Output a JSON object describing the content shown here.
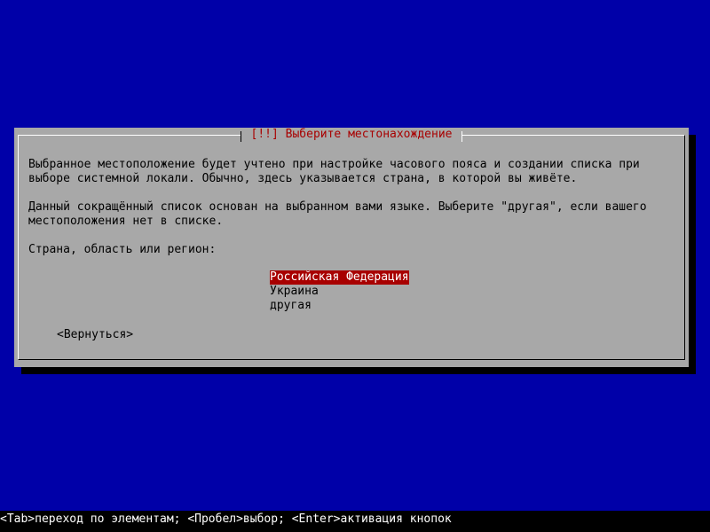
{
  "dialog": {
    "title": "[!!] Выберите местонахождение",
    "paragraph1": "Выбранное местоположение будет учтено при настройке часового пояса и создании списка при\nвыборе системной локали. Обычно, здесь указывается страна, в которой вы живёте.",
    "paragraph2": "Данный сокращённый список основан на выбранном вами языке. Выберите \"другая\", если вашего\nместоположения нет в списке.",
    "prompt": "Страна, область или регион:",
    "options": [
      {
        "label": "Российская Федерация",
        "selected": true
      },
      {
        "label": "Украина",
        "selected": false
      },
      {
        "label": "другая",
        "selected": false
      }
    ],
    "back_label": "<Вернуться>"
  },
  "status_bar": {
    "text": "<Tab>переход по элементам; <Пробел>выбор; <Enter>активация кнопок"
  },
  "colors": {
    "background": "#0000a8",
    "dialog": "#a8a8a8",
    "title": "#a80000",
    "selection": "#a80000"
  }
}
